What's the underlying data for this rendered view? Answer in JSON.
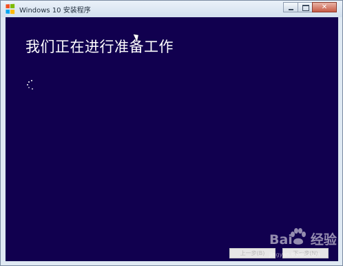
{
  "window": {
    "title": "Windows 10 安装程序",
    "icon": "windows-logo-icon",
    "controls": [
      "minimize-icon",
      "maximize-icon",
      "close-icon"
    ],
    "logo_colors": [
      "#f25022",
      "#7fba00",
      "#00a4ef",
      "#ffb900"
    ]
  },
  "setup": {
    "heading": "我们正在进行准备工作",
    "spinner_icon": "loading-spinner-icon",
    "background_color": "#11004f"
  },
  "footer": {
    "back_label": "上一步(B)",
    "next_label": "下一步(N)"
  },
  "watermark": {
    "brand_part1": "Bai",
    "brand_part2": "经验",
    "url": "jingyan.baidu.com"
  }
}
